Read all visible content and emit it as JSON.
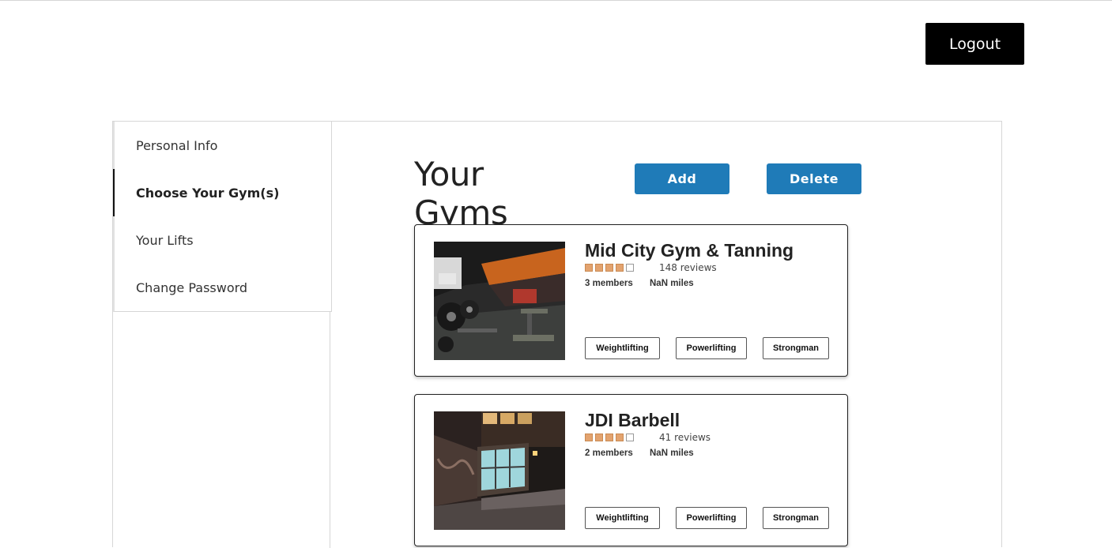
{
  "header": {
    "logout_label": "Logout"
  },
  "sidebar": {
    "items": [
      {
        "label": "Personal Info",
        "active": false
      },
      {
        "label": "Choose Your Gym(s)",
        "active": true
      },
      {
        "label": "Your Lifts",
        "active": false
      },
      {
        "label": "Change Password",
        "active": false
      }
    ]
  },
  "main": {
    "title": "Your Gyms",
    "add_label": "Add",
    "delete_label": "Delete",
    "gyms": [
      {
        "name": "Mid City Gym & Tanning",
        "rating": 4,
        "rating_max": 5,
        "reviews": "148 reviews",
        "members": "3 members",
        "distance": "NaN miles",
        "tags": [
          "Weightlifting",
          "Powerlifting",
          "Strongman"
        ]
      },
      {
        "name": "JDI Barbell",
        "rating": 4,
        "rating_max": 5,
        "reviews": "41 reviews",
        "members": "2 members",
        "distance": "NaN miles",
        "tags": [
          "Weightlifting",
          "Powerlifting",
          "Strongman"
        ]
      }
    ]
  },
  "colors": {
    "accent": "#1f7bb8",
    "star_fill": "#e3a36f",
    "logout_bg": "#000000"
  }
}
